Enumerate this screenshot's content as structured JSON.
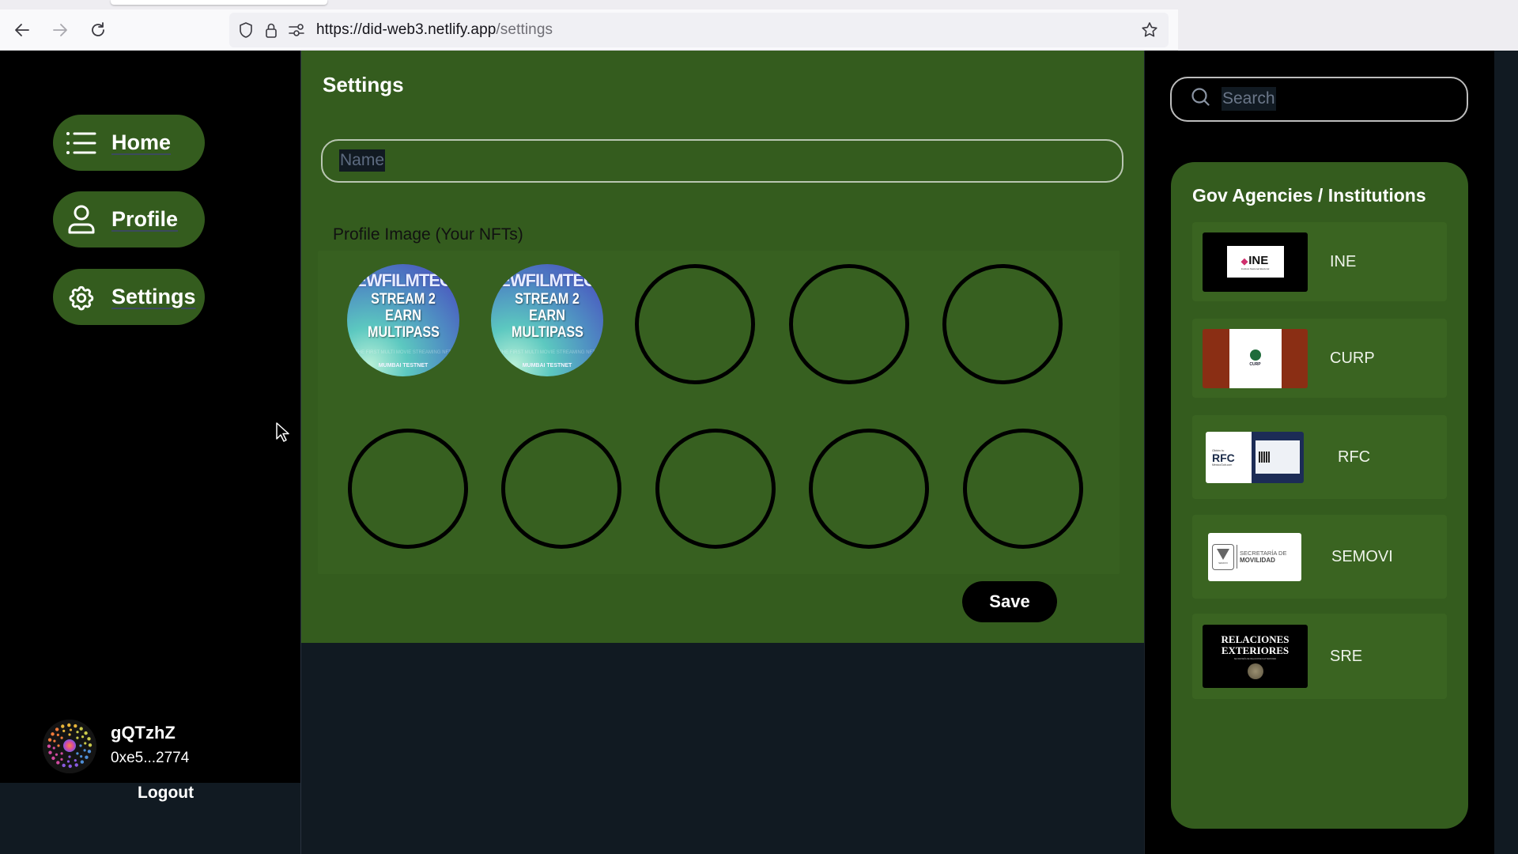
{
  "browser": {
    "url_host": "https://did-web3.netlify.app",
    "url_path": "/settings",
    "icons": {
      "back": "arrow-left-icon",
      "forward": "arrow-right-icon",
      "reload": "reload-icon",
      "tracking": "shield-icon",
      "secure": "lock-icon",
      "permissions": "permissions-icon",
      "bookmark": "star-icon"
    }
  },
  "sidebar": {
    "items": [
      {
        "label": "Home",
        "icon": "list-icon"
      },
      {
        "label": "Profile",
        "icon": "user-icon"
      },
      {
        "label": "Settings",
        "icon": "gear-icon"
      }
    ],
    "user": {
      "name": "gQTzhZ",
      "address": "0xe5...2774"
    },
    "logout_label": "Logout"
  },
  "main": {
    "title": "Settings",
    "name_input": {
      "placeholder": "Name",
      "value": ""
    },
    "profile_image_label": "Profile Image (Your NFTs)",
    "nfts": [
      {
        "filled": true,
        "title": "NEWFILMTECH",
        "line1": "STREAM 2 EARN",
        "line2": "MULTIPASS",
        "small": "THE FIRST MULTI MOVIE STREAMING NFT",
        "network": "MUMBAI TESTNET"
      },
      {
        "filled": true,
        "title": "NEWFILMTECH",
        "line1": "STREAM 2 EARN",
        "line2": "MULTIPASS",
        "small": "THE FIRST MULTI MOVIE STREAMING NFT",
        "network": "MUMBAI TESTNET"
      },
      {
        "filled": false
      },
      {
        "filled": false
      },
      {
        "filled": false
      },
      {
        "filled": false
      },
      {
        "filled": false
      },
      {
        "filled": false
      },
      {
        "filled": false
      },
      {
        "filled": false
      }
    ],
    "save_label": "Save"
  },
  "right": {
    "search": {
      "placeholder": "Search",
      "value": ""
    },
    "agencies_title": "Gov Agencies / Institutions",
    "agencies": [
      {
        "name": "INE",
        "logo_text": "INE",
        "logo_sub": "Instituto Nacional Electoral"
      },
      {
        "name": "CURP",
        "logo_text": "CURP"
      },
      {
        "name": "RFC",
        "logo_text": "RFC",
        "logo_pre": "Obtén tu",
        "logo_sub": "MexicoGob.com"
      },
      {
        "name": "SEMOVI",
        "logo_text": "SECRETARÍA DE",
        "logo_sub": "MOVILIDAD",
        "logo_box": "SEMOVI"
      },
      {
        "name": "SRE",
        "logo_text": "RELACIONES EXTERIORES",
        "logo_sub": "SECRETARÍA DE RELACIONES EXTERIORES"
      }
    ]
  },
  "colors": {
    "panel_green": "#345c1e",
    "sidebar_black": "#000000",
    "page_navy": "#111a22",
    "text_white": "#ffffff"
  }
}
